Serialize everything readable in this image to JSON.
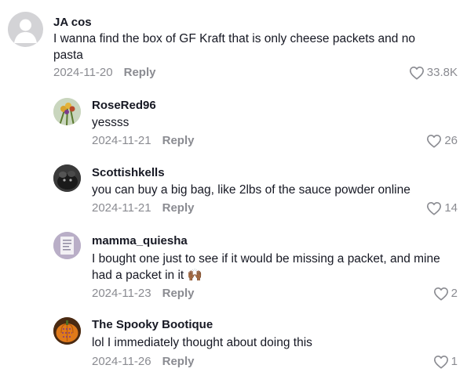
{
  "comments": [
    {
      "username": "JA cos",
      "text": "I wanna find the box of GF Kraft that is only cheese packets and no pasta",
      "date": "2024-11-20",
      "reply_label": "Reply",
      "likes": "33.8K",
      "avatar": "default-avatar-icon"
    },
    {
      "username": "RoseRed96",
      "text": "yessss",
      "date": "2024-11-21",
      "reply_label": "Reply",
      "likes": "26",
      "avatar": "flowers-photo"
    },
    {
      "username": "Scottishkells",
      "text": "you can buy a big bag, like 2lbs of the sauce powder online",
      "date": "2024-11-21",
      "reply_label": "Reply",
      "likes": "14",
      "avatar": "dark-pet-photo"
    },
    {
      "username": "mamma_quiesha",
      "text": "I bought one just to see if it would be missing a packet, and mine had a packet in it 🙌🏾",
      "date": "2024-11-23",
      "reply_label": "Reply",
      "likes": "2",
      "avatar": "sign-photo"
    },
    {
      "username": "The Spooky Bootique",
      "text": "lol I immediately thought about doing this",
      "date": "2024-11-26",
      "reply_label": "Reply",
      "likes": "1",
      "avatar": "pumpkin-photo"
    }
  ],
  "colors": {
    "text": "#161823",
    "secondary": "#8a8b91",
    "avatar_default": "#d3d3d6"
  }
}
